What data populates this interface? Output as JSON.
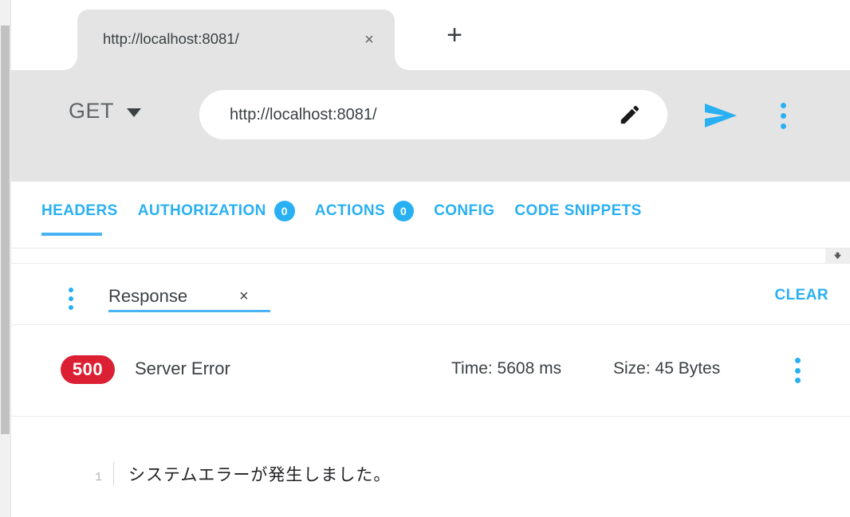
{
  "window": {
    "scrollbar": {
      "name": "vertical-scrollbar"
    }
  },
  "browser_tab": {
    "title": "http://localhost:8081/",
    "close_label": "×",
    "new_tab_label": "+"
  },
  "request": {
    "method": "GET",
    "method_dropdown_icon": "chevron-down-icon",
    "url": "http://localhost:8081/",
    "url_placeholder": "http://localhost:8081/",
    "edit_icon": "pencil-icon",
    "send_icon": "send-arrow-icon",
    "menu_icon": "kebab-menu-icon"
  },
  "section_tabs": [
    {
      "label": "HEADERS",
      "badge": null,
      "active": true
    },
    {
      "label": "AUTHORIZATION",
      "badge": "0",
      "active": false
    },
    {
      "label": "ACTIONS",
      "badge": "0",
      "active": false
    },
    {
      "label": "CONFIG",
      "badge": null,
      "active": false
    },
    {
      "label": "CODE SNIPPETS",
      "badge": null,
      "active": false
    }
  ],
  "response_tab": {
    "menu_icon": "kebab-menu-icon",
    "label": "Response",
    "close_label": "×",
    "clear_label": "CLEAR"
  },
  "status": {
    "code": "500",
    "text": "Server Error",
    "time": "Time: 5608 ms",
    "size": "Size: 45 Bytes",
    "menu_icon": "kebab-menu-icon"
  },
  "body": {
    "line_number": "1",
    "content": "システムエラーが発生しました。"
  },
  "colors": {
    "accent": "#29b0f2",
    "error": "#dc2033",
    "toolbar_bg": "#e4e4e4",
    "tab_bg": "#e4e4e4"
  }
}
